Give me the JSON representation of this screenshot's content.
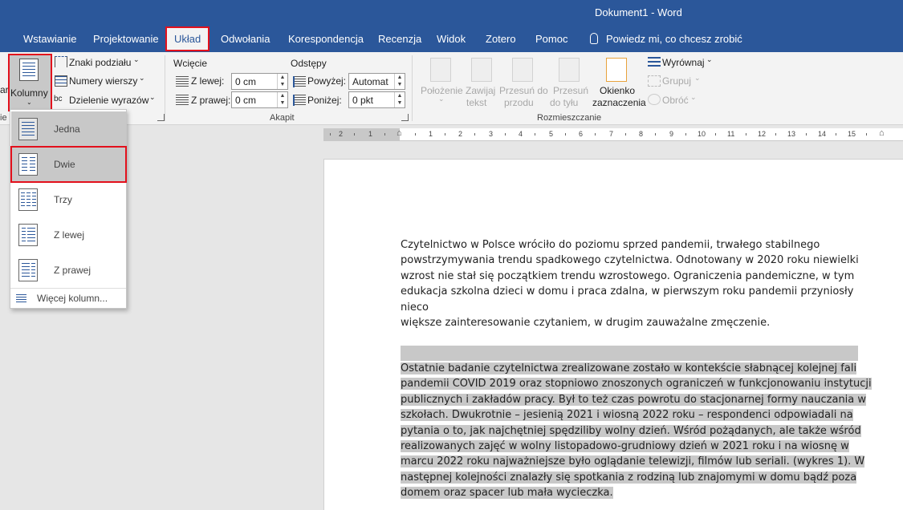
{
  "window": {
    "title": "Dokument1 - Word"
  },
  "tabs": [
    "Wstawianie",
    "Projektowanie",
    "Układ",
    "Odwołania",
    "Korespondencja",
    "Recenzja",
    "Widok",
    "Zotero",
    "Pomoc"
  ],
  "tell_me": "Powiedz mi, co chcesz zrobić",
  "ribbon": {
    "page_setup": {
      "cut_label": "ar",
      "kolumny": "Kolumny",
      "znaki_podzialu": "Znaki podziału",
      "numery_wierszy": "Numery wierszy",
      "dzielenie_wyrazow": "Dzielenie wyrazów",
      "group_label_cut": "ie"
    },
    "paragraph": {
      "wciecie": "Wcięcie",
      "odstepy": "Odstępy",
      "z_lewej": "Z lewej:",
      "z_lewej_value": "0 cm",
      "z_prawej": "Z prawej:",
      "z_prawej_value": "0 cm",
      "powyzej": "Powyżej:",
      "powyzej_value": "Automat",
      "ponizej": "Poniżej:",
      "ponizej_value": "0 pkt",
      "group_label": "Akapit"
    },
    "arrange": {
      "polozenie": "Położenie",
      "zawijaj": "Zawijaj",
      "tekst": "tekst",
      "przesun_do_przodu_1": "Przesuń do",
      "przesun_do_przodu_2": "przodu",
      "przesun_do_tylu_1": "Przesuń",
      "przesun_do_tylu_2": "do tyłu",
      "okienko_1": "Okienko",
      "okienko_2": "zaznaczenia",
      "wyrownaj": "Wyrównaj",
      "grupuj": "Grupuj",
      "obroc": "Obróć",
      "group_label": "Rozmieszczanie"
    }
  },
  "columns_menu": {
    "items": [
      "Jedna",
      "Dwie",
      "Trzy",
      "Z lewej",
      "Z prawej"
    ],
    "more": "Więcej kolumn..."
  },
  "ruler": {
    "numbers": [
      "2",
      "1",
      "1",
      "2",
      "3",
      "4",
      "5",
      "6",
      "7",
      "8",
      "9",
      "10",
      "11",
      "12",
      "13",
      "14",
      "15"
    ]
  },
  "document": {
    "para1": [
      "Czytelnictwo w Polsce wróciło do poziomu sprzed pandemii, trwałego stabilnego",
      "powstrzymywania trendu spadkowego czytelnictwa. Odnotowany w 2020 roku niewielki",
      "wzrost nie stał się początkiem trendu wzrostowego. Ograniczenia pandemiczne, w tym",
      "edukacja szkolna dzieci w domu i praca zdalna, w pierwszym roku pandemii przyniosły nieco",
      "większe zainteresowanie czytaniem, w drugim zauważalne zmęczenie."
    ],
    "para2": [
      "Ostatnie badanie czytelnictwa zrealizowane zostało w kontekście słabnącej kolejnej fali",
      "pandemii COVID 2019 oraz stopniowo znoszonych ograniczeń w funkcjonowaniu instytucji",
      "publicznych i zakładów pracy. Był to też czas powrotu do stacjonarnej formy nauczania w",
      "szkołach. Dwukrotnie – jesienią 2021 i wiosną 2022 roku – respondenci odpowiadali na",
      "pytania o to, jak najchętniej spędziliby wolny dzień. Wśród pożądanych, ale także wśród",
      "realizowanych zajęć w wolny listopadowo-grudniowy dzień w 2021 roku i na wiosnę w",
      "marcu 2022 roku najważniejsze było oglądanie telewizji, filmów lub seriali. (wykres 1). W",
      "następnej kolejności znalazły się spotkania z rodziną lub znajomymi w domu bądź poza",
      "domem oraz spacer lub mała wycieczka."
    ]
  },
  "colors": {
    "accent": "#2b579a",
    "highlight_border": "#e3101c",
    "selection": "#c8c8c8"
  }
}
